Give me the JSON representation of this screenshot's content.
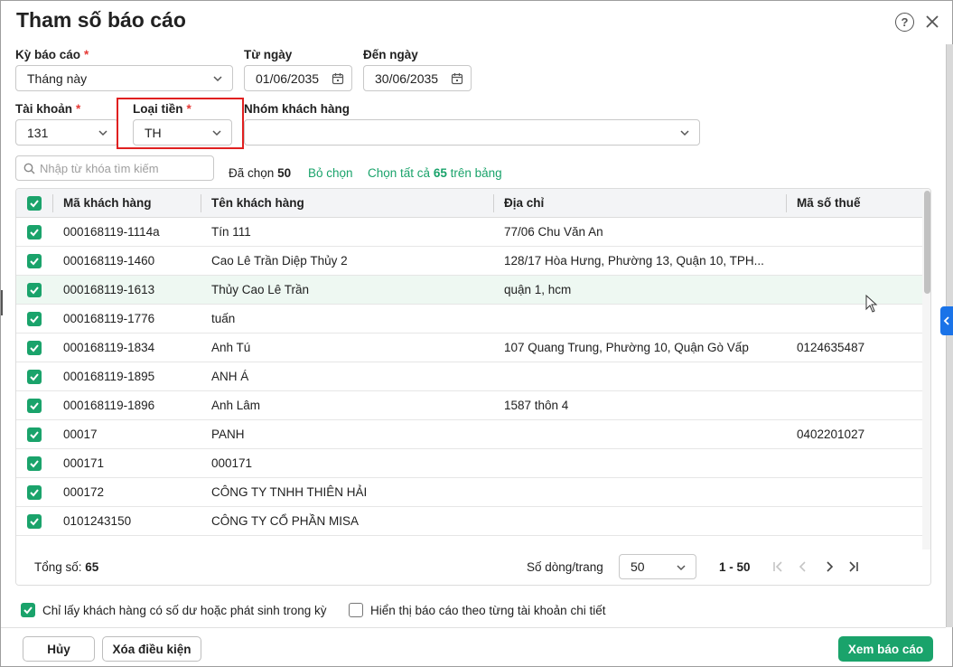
{
  "dialog": {
    "title": "Tham số báo cáo"
  },
  "filters": {
    "period_label": "Kỳ báo cáo",
    "period_value": "Tháng này",
    "from_label": "Từ ngày",
    "from_value": "01/06/2035",
    "to_label": "Đến ngày",
    "to_value": "30/06/2035",
    "account_label": "Tài khoản",
    "account_value": "131",
    "currency_label": "Loại tiền",
    "currency_value": "TH",
    "group_label": "Nhóm khách hàng",
    "group_value": "",
    "required_mark": "*"
  },
  "search": {
    "placeholder": "Nhập từ khóa tìm kiếm"
  },
  "selection": {
    "selected_prefix": "Đã chọn",
    "selected_count": "50",
    "deselect": "Bỏ chọn",
    "select_all_prefix": "Chọn tất cả",
    "select_all_count": "65",
    "select_all_suffix": "trên bảng"
  },
  "table": {
    "columns": [
      "Mã khách hàng",
      "Tên khách hàng",
      "Địa chỉ",
      "Mã số thuế"
    ],
    "rows": [
      {
        "code": "000168119-1114a",
        "name": "Tín 111",
        "address": "77/06 Chu Văn An",
        "tax": ""
      },
      {
        "code": "000168119-1460",
        "name": "Cao Lê Trần Diệp Thủy 2",
        "address": "128/17 Hòa Hưng, Phường 13, Quận 10, TPH...",
        "tax": ""
      },
      {
        "code": "000168119-1613",
        "name": "Thủy Cao Lê Trần",
        "address": "quận 1, hcm",
        "tax": ""
      },
      {
        "code": "000168119-1776",
        "name": "tuấn",
        "address": "",
        "tax": ""
      },
      {
        "code": "000168119-1834",
        "name": "Anh Tú",
        "address": "107 Quang Trung, Phường 10, Quận Gò Vấp",
        "tax": "0124635487"
      },
      {
        "code": "000168119-1895",
        "name": "ANH Á",
        "address": "",
        "tax": ""
      },
      {
        "code": "000168119-1896",
        "name": "Anh Lâm",
        "address": "1587 thôn 4",
        "tax": ""
      },
      {
        "code": "00017",
        "name": "PANH",
        "address": "",
        "tax": "0402201027"
      },
      {
        "code": "000171",
        "name": "000171",
        "address": "",
        "tax": ""
      },
      {
        "code": "000172",
        "name": "CÔNG TY TNHH THIÊN HẢI",
        "address": "",
        "tax": ""
      },
      {
        "code": "0101243150",
        "name": "CÔNG TY CỔ PHẦN MISA",
        "address": "",
        "tax": ""
      }
    ],
    "total_label": "Tổng số:",
    "total_value": "65",
    "page_size_label": "Số dòng/trang",
    "page_size_value": "50",
    "range": "1 - 50"
  },
  "options": {
    "only_with_balance": "Chỉ lấy khách hàng có số dư hoặc phát sinh trong kỳ",
    "by_detail_account": "Hiển thị báo cáo theo từng tài khoản chi tiết"
  },
  "buttons": {
    "cancel": "Hủy",
    "clear": "Xóa điều kiện",
    "view": "Xem báo cáo"
  },
  "colors": {
    "accent": "#1aa36b",
    "highlight_border": "#e02020",
    "side_tab": "#1a73e8"
  }
}
